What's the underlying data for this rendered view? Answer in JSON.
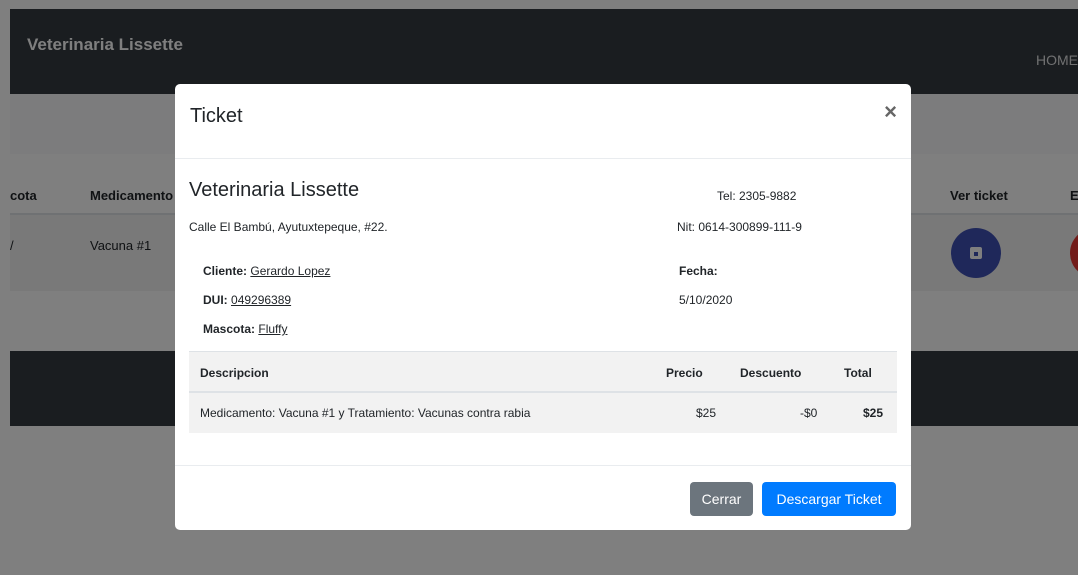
{
  "navbar": {
    "brand": "Veterinaria Lissette",
    "home": "HOME"
  },
  "table": {
    "headers": [
      "cota",
      "Medicamento",
      "Ver ticket",
      "E"
    ],
    "row": {
      "mascota_tail": "/",
      "medicamento": "Vacuna #1"
    }
  },
  "modal": {
    "title": "Ticket",
    "close": "×",
    "company": {
      "name": "Veterinaria Lissette",
      "address": "Calle El Bambú, Ayutuxtepeque, #22.",
      "tel": "Tel: 2305-9882",
      "nit": "Nit: 0614-300899-111-9"
    },
    "client": {
      "cliente_label": "Cliente:",
      "cliente_value": "Gerardo Lopez",
      "dui_label": "DUI:",
      "dui_value": "049296389",
      "mascota_label": "Mascota:",
      "mascota_value": "Fluffy",
      "fecha_label": "Fecha:",
      "fecha_value": "5/10/2020"
    },
    "ticket_table": {
      "headers": [
        "Descripcion",
        "Precio",
        "Descuento",
        "Total"
      ],
      "row": {
        "descripcion": "Medicamento: Vacuna #1 y Tratamiento: Vacunas contra rabia",
        "precio": "$25",
        "descuento": "-$0",
        "total": "$25"
      }
    },
    "buttons": {
      "close": "Cerrar",
      "download": "Descargar Ticket"
    }
  },
  "colors": {
    "navbar": "#343a40",
    "primary": "#007bff",
    "secondary": "#6c757d",
    "circle_blue": "#3f51b5",
    "circle_red": "#e53935"
  }
}
